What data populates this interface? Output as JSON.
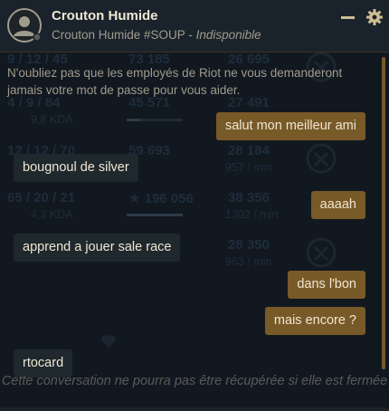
{
  "header": {
    "name": "Crouton Humide",
    "riot_id": "Crouton Humide #SOUP",
    "separator": " - ",
    "status": "Indisponible",
    "icons": [
      "avatar-icon",
      "minimize-icon",
      "gear-icon"
    ]
  },
  "background_stats": [
    {
      "kda": "9 / 12 / 45",
      "ratio": "",
      "gold": "73 185",
      "gold_fill": 0,
      "damage": "26 695",
      "rate": ""
    },
    {
      "kda": "4 / 9 / 84",
      "ratio": "9,8 KDA",
      "gold": "45 571",
      "gold_fill": 0.25,
      "damage": "27 491",
      "rate": ""
    },
    {
      "kda": "12 / 12 / 70",
      "ratio": "",
      "gold": "59 693",
      "gold_fill": 0,
      "damage": "28 184",
      "rate": "957 / min"
    },
    {
      "kda": "65 / 20 / 21",
      "ratio": "4,3 KDA",
      "gold": "★ 196 056",
      "gold_fill": 1,
      "damage": "38 356",
      "rate": "1302 / min"
    },
    {
      "kda": "",
      "ratio": "",
      "gold": "",
      "gold_fill": 0,
      "damage": "28 350",
      "rate": "963 / min"
    }
  ],
  "chat": {
    "notice": "N'oubliez pas que les employés de Riot ne vous demanderont jamais votre mot de passe pour vous aider.",
    "messages": [
      {
        "direction": "out",
        "text": "salut mon meilleur ami"
      },
      {
        "direction": "in",
        "text": "bougnoul de silver"
      },
      {
        "direction": "out",
        "text": "aaaah"
      },
      {
        "direction": "in",
        "text": "apprend a jouer sale race"
      },
      {
        "direction": "out",
        "text": "dans l'bon"
      },
      {
        "direction": "out",
        "text": "mais encore ?"
      },
      {
        "direction": "in",
        "text": "rtocard"
      }
    ],
    "footer_note": "Cette conversation ne pourra pas être récupérée si elle est fermée"
  },
  "colors": {
    "outgoing_bubble": "#785a28",
    "incoming_bubble": "#1e282d",
    "text_light": "#f0e6d2",
    "text_muted": "#a09b8c"
  }
}
